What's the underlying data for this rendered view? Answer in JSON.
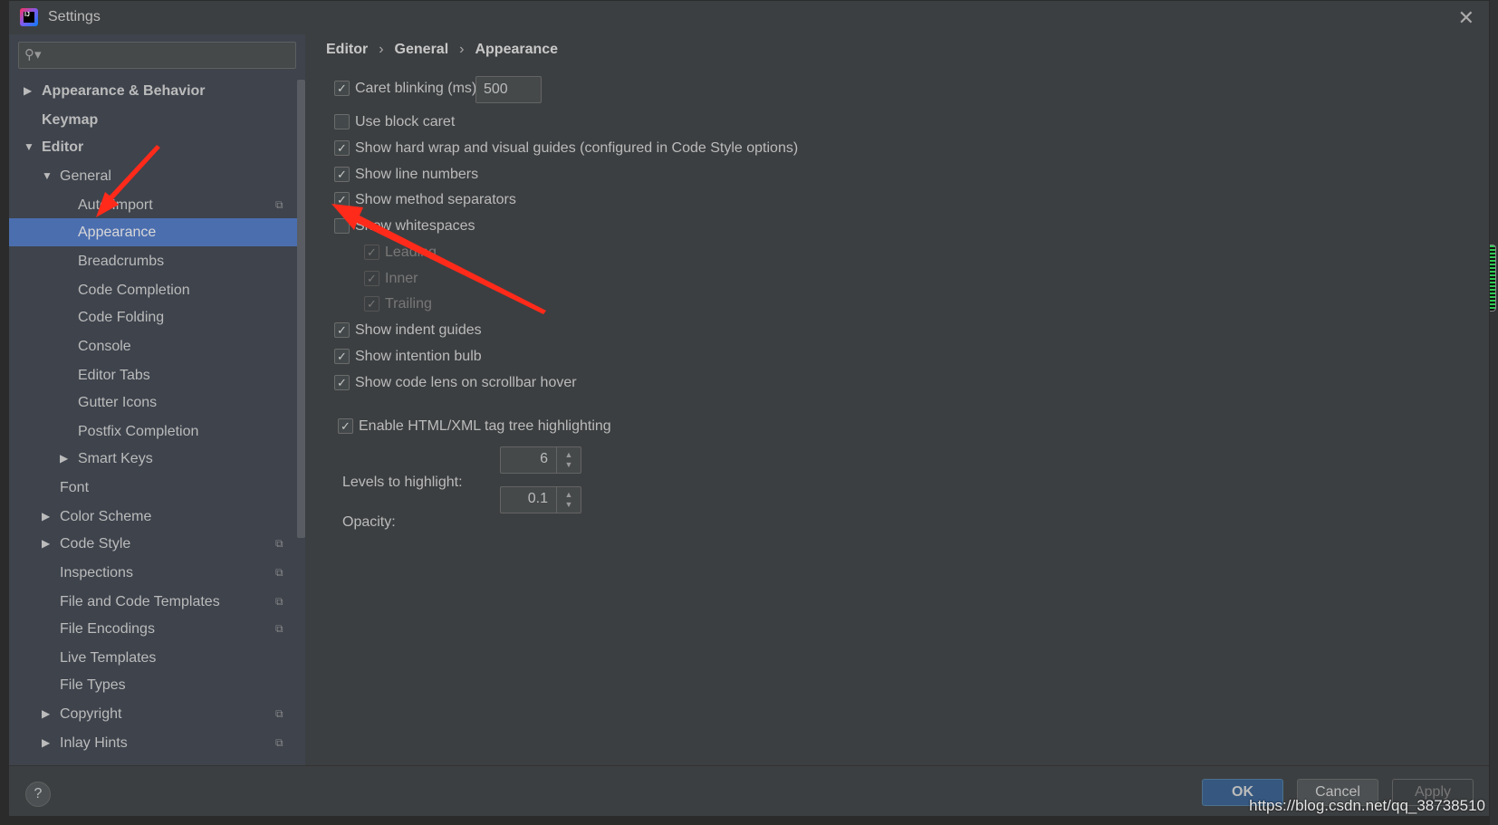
{
  "window": {
    "title": "Settings"
  },
  "search": {
    "placeholder": ""
  },
  "sidebar": {
    "items": [
      {
        "label": "Appearance & Behavior",
        "level": 0,
        "expandable": true,
        "expanded": false,
        "bold": true
      },
      {
        "label": "Keymap",
        "level": 0,
        "bold": true
      },
      {
        "label": "Editor",
        "level": 0,
        "expandable": true,
        "expanded": true,
        "bold": true
      },
      {
        "label": "General",
        "level": 1,
        "expandable": true,
        "expanded": true
      },
      {
        "label": "Auto Import",
        "level": 2,
        "project": true
      },
      {
        "label": "Appearance",
        "level": 2,
        "selected": true
      },
      {
        "label": "Breadcrumbs",
        "level": 2
      },
      {
        "label": "Code Completion",
        "level": 2
      },
      {
        "label": "Code Folding",
        "level": 2
      },
      {
        "label": "Console",
        "level": 2
      },
      {
        "label": "Editor Tabs",
        "level": 2
      },
      {
        "label": "Gutter Icons",
        "level": 2
      },
      {
        "label": "Postfix Completion",
        "level": 2
      },
      {
        "label": "Smart Keys",
        "level": 2,
        "expandable": true,
        "expanded": false
      },
      {
        "label": "Font",
        "level": 1
      },
      {
        "label": "Color Scheme",
        "level": 1,
        "expandable": true,
        "expanded": false
      },
      {
        "label": "Code Style",
        "level": 1,
        "expandable": true,
        "expanded": false,
        "project": true
      },
      {
        "label": "Inspections",
        "level": 1,
        "project": true
      },
      {
        "label": "File and Code Templates",
        "level": 1,
        "project": true
      },
      {
        "label": "File Encodings",
        "level": 1,
        "project": true
      },
      {
        "label": "Live Templates",
        "level": 1
      },
      {
        "label": "File Types",
        "level": 1
      },
      {
        "label": "Copyright",
        "level": 1,
        "expandable": true,
        "expanded": false,
        "project": true
      },
      {
        "label": "Inlay Hints",
        "level": 1,
        "expandable": true,
        "expanded": false,
        "project": true
      }
    ]
  },
  "breadcrumb": [
    "Editor",
    "General",
    "Appearance"
  ],
  "options": [
    {
      "label": "Caret blinking (ms):",
      "checked": true,
      "value": "500"
    },
    {
      "label": "Use block caret",
      "checked": false
    },
    {
      "label": "Show hard wrap and visual guides (configured in Code Style options)",
      "checked": true
    },
    {
      "label": "Show line numbers",
      "checked": true
    },
    {
      "label": "Show method separators",
      "checked": true
    },
    {
      "label": "Show whitespaces",
      "checked": false
    },
    {
      "label": "Leading",
      "checked": true,
      "disabled": true
    },
    {
      "label": "Inner",
      "checked": true,
      "disabled": true
    },
    {
      "label": "Trailing",
      "checked": true,
      "disabled": true
    },
    {
      "label": "Show indent guides",
      "checked": true
    },
    {
      "label": "Show intention bulb",
      "checked": true
    },
    {
      "label": "Show code lens on scrollbar hover",
      "checked": true
    },
    {
      "label": "Enable HTML/XML tag tree highlighting",
      "checked": true
    }
  ],
  "levels": {
    "label": "Levels to highlight:",
    "value": "6"
  },
  "opacity": {
    "label": "Opacity:",
    "value": "0.1"
  },
  "footer": {
    "help": "?",
    "ok": "OK",
    "cancel": "Cancel",
    "apply": "Apply"
  },
  "watermark": "https://blog.csdn.net/qq_38738510",
  "colors": {
    "selection": "#4b6eaf",
    "ok_button": "#365880",
    "annotation_arrow": "#ff2a1a"
  }
}
